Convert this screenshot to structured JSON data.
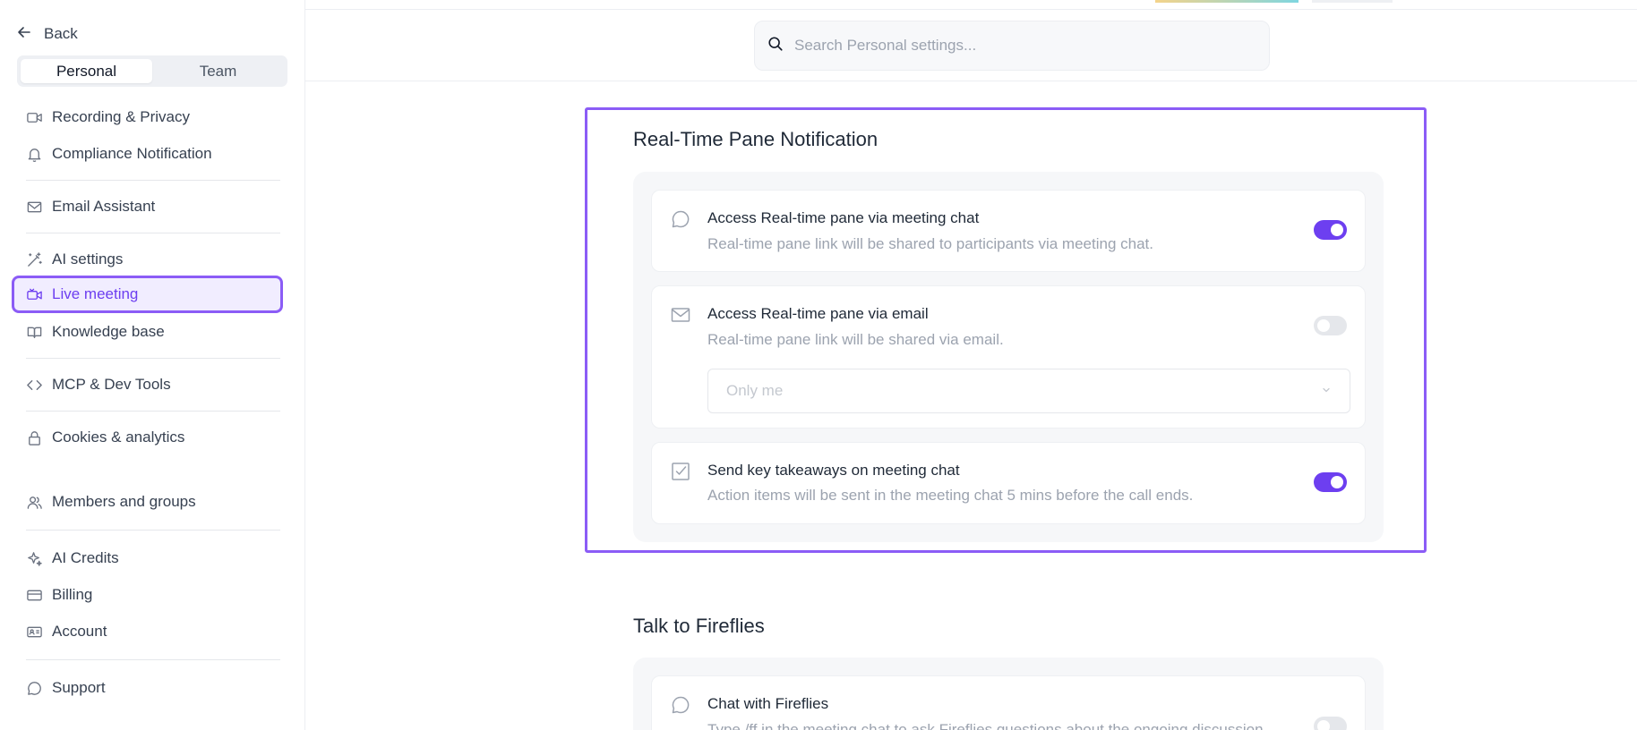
{
  "sidebar": {
    "back_label": "Back",
    "tabs": [
      {
        "label": "Personal",
        "active": true
      },
      {
        "label": "Team",
        "active": false
      }
    ],
    "items": [
      {
        "label": "Recording & Privacy",
        "icon": "video-icon"
      },
      {
        "label": "Compliance Notification",
        "icon": "bell-icon"
      },
      {
        "label": "Email Assistant",
        "icon": "mail-icon"
      },
      {
        "label": "AI settings",
        "icon": "magic-wand-icon"
      },
      {
        "label": "Live meeting",
        "icon": "live-video-icon",
        "active": true
      },
      {
        "label": "Knowledge base",
        "icon": "book-icon"
      },
      {
        "label": "MCP & Dev Tools",
        "icon": "code-icon"
      },
      {
        "label": "Cookies & analytics",
        "icon": "lock-icon"
      },
      {
        "label": "Members and groups",
        "icon": "users-icon"
      },
      {
        "label": "AI Credits",
        "icon": "sparkle-icon"
      },
      {
        "label": "Billing",
        "icon": "credit-card-icon"
      },
      {
        "label": "Account",
        "icon": "id-card-icon"
      },
      {
        "label": "Support",
        "icon": "chat-bubble-icon"
      }
    ]
  },
  "search": {
    "placeholder": "Search Personal settings..."
  },
  "realtime": {
    "title": "Real-Time Pane Notification",
    "cards": [
      {
        "title": "Access Real-time pane via meeting chat",
        "desc": "Real-time pane link will be shared to participants via meeting chat.",
        "icon": "chat-bubble-icon",
        "enabled": true
      },
      {
        "title": "Access Real-time pane via email",
        "desc": "Real-time pane link will be shared via email.",
        "icon": "mail-icon",
        "enabled": false,
        "select_value": "Only me"
      },
      {
        "title": "Send key takeaways on meeting chat",
        "desc": "Action items will be sent in the meeting chat 5 mins before the call ends.",
        "icon": "checkbox-icon",
        "enabled": true
      }
    ]
  },
  "fireflies": {
    "title": "Talk to Fireflies",
    "cards": [
      {
        "title": "Chat with Fireflies",
        "desc": "Type /ff in the meeting chat to ask Fireflies questions about the ongoing discussion.",
        "icon": "chat-bubble-icon",
        "enabled": false
      }
    ]
  },
  "colors": {
    "accent": "#6d3ff0",
    "highlight": "#8b5cf6"
  }
}
